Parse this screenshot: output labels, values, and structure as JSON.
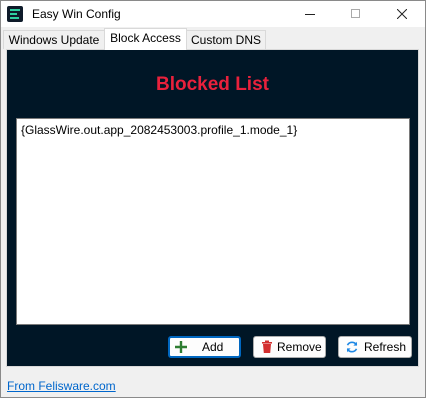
{
  "window": {
    "title": "Easy Win Config",
    "app_icon": "app-logo-icon"
  },
  "titlebar_buttons": {
    "minimize": "minimize-icon",
    "maximize": "maximize-icon",
    "close": "close-icon"
  },
  "tabs": [
    {
      "label": "Windows Update",
      "active": false
    },
    {
      "label": "Block Access",
      "active": true
    },
    {
      "label": "Custom DNS",
      "active": false
    }
  ],
  "panel": {
    "title": "Blocked List",
    "title_color": "#e8213c",
    "background": "#001626",
    "list_items": [
      "{GlassWire.out.app_2082453003.profile_1.mode_1}"
    ]
  },
  "buttons": {
    "add": {
      "label": "Add",
      "icon": "plus-icon",
      "icon_color": "#2e7d32"
    },
    "remove": {
      "label": "Remove",
      "icon": "trash-icon",
      "icon_color": "#d32f2f"
    },
    "refresh": {
      "label": "Refresh",
      "icon": "refresh-icon",
      "icon_color": "#1e88e5"
    }
  },
  "footer": {
    "link_text": "From Felisware.com"
  }
}
